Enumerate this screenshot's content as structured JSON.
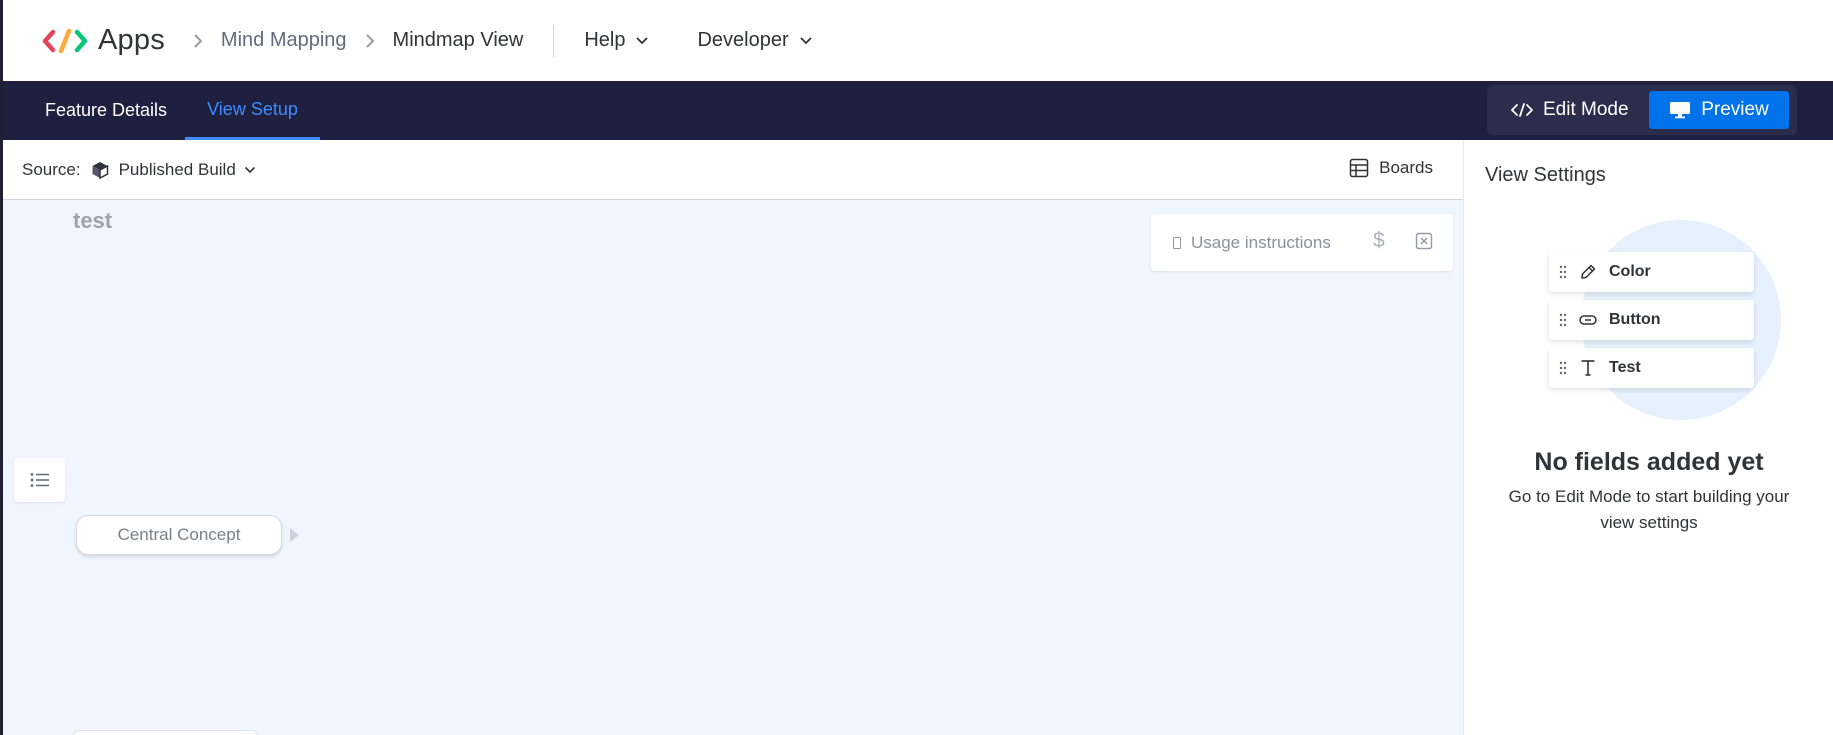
{
  "header": {
    "app_title": "Apps",
    "breadcrumbs": [
      {
        "label": "Mind Mapping"
      },
      {
        "label": "Mindmap View"
      }
    ],
    "menus": [
      {
        "label": "Help",
        "icon": "chevron-down-icon"
      },
      {
        "label": "Developer",
        "icon": "chevron-down-icon"
      }
    ]
  },
  "nav": {
    "tabs": [
      {
        "label": "Feature Details",
        "active": false
      },
      {
        "label": "View Setup",
        "active": true
      }
    ],
    "mode_switch": {
      "edit_label": "Edit Mode",
      "preview_label": "Preview",
      "selected": "Preview"
    }
  },
  "source_bar": {
    "source_label": "Source:",
    "source_value": "Published Build",
    "boards_label": "Boards"
  },
  "canvas": {
    "title": "test",
    "usage_instructions": "Usage instructions",
    "dollar_symbol": "$",
    "central_node": "Central Concept"
  },
  "view_settings": {
    "title": "View Settings",
    "fields": [
      {
        "name": "Color",
        "icon": "eyedropper-icon"
      },
      {
        "name": "Button",
        "icon": "button-pill-icon"
      },
      {
        "name": "Test",
        "icon": "text-icon"
      }
    ],
    "empty_title": "No fields added yet",
    "empty_description": "Go to Edit Mode to start building your view settings"
  },
  "colors": {
    "nav_bg": "#1f2040",
    "accent_blue": "#0073ea",
    "active_tab": "#3a8cff",
    "canvas_bg": "#f1f5fd",
    "illustration_circle": "#e6f1fd"
  }
}
